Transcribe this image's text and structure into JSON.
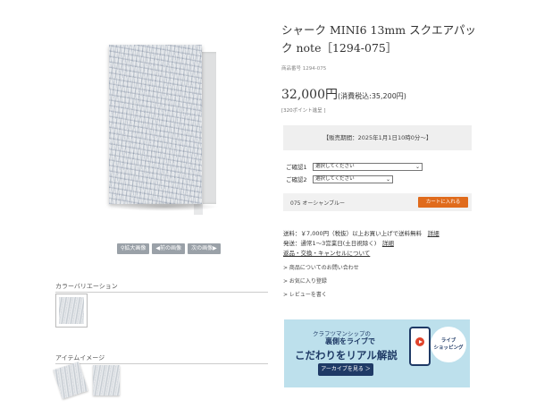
{
  "product": {
    "title": "シャーク MINI6 13mm スクエアパック note［1294-075］",
    "code": "商品番号 1294-075",
    "price": "32,000円",
    "price_tax": "(消費税込:35,200円)",
    "points": "[320ポイント進呈 ]",
    "sale_period": "【販売期間：2025年1月1日10時0分〜】"
  },
  "options": [
    {
      "label": "ご確認1",
      "value": "選択してください"
    },
    {
      "label": "ご確認2",
      "value": "選択してください"
    }
  ],
  "cart": {
    "variant": "075 オーシャンブルー",
    "button": "カートに入れる"
  },
  "shipping": {
    "line1": "送料：￥7,000円（税抜）以上お買い上げで送料無料",
    "line1_link": "詳細",
    "line2": "発送：通常1〜3営業日(土日祝除く)",
    "line2_link": "詳細",
    "line3": "返品・交換・キャンセルについて"
  },
  "menu": [
    "> 商品についてのお問い合わせ",
    "> お気に入り登録",
    "> レビューを書く"
  ],
  "image_buttons": [
    "拡大画像",
    "前の画像",
    "次の画像"
  ],
  "sections": {
    "color_variation": "カラーバリエーション",
    "item_image": "アイテムイメージ"
  },
  "banner": {
    "line1": "クラフツマンシップの",
    "line2": "裏側をライブで",
    "line3": "こだわりをリアル解説",
    "button": "アーカイブを見る ＞",
    "badge": "ライブ\nショッピング"
  },
  "icons": {
    "zoom": "magnifier-icon",
    "prev": "triangle-left-icon",
    "next": "triangle-right-icon"
  },
  "colors": {
    "accent": "#e06b1c",
    "banner_bg": "#bde0ec",
    "banner_text": "#1f3a66"
  }
}
